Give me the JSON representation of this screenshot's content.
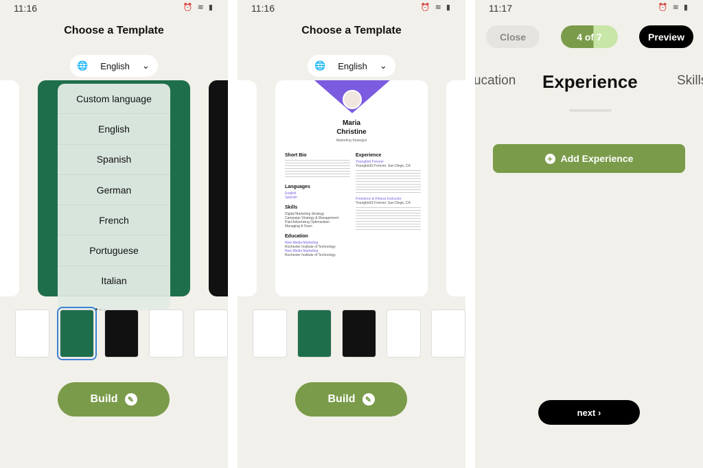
{
  "screens": [
    {
      "time": "11:16",
      "title": "Choose a Template",
      "language": "English",
      "build": "Build",
      "languages": [
        "Custom language",
        "English",
        "Spanish",
        "German",
        "French",
        "Portuguese",
        "Italian",
        "Japanese"
      ]
    },
    {
      "time": "11:16",
      "title": "Choose a Template",
      "language": "English",
      "build": "Build",
      "resume": {
        "first": "Maria",
        "last": "Christine",
        "role": "Marketing Strategist",
        "short_bio": "Short Bio",
        "languages_h": "Languages",
        "languages": [
          "English",
          "Spanish"
        ],
        "skills_h": "Skills",
        "skills": [
          "Digital Marketing Strategy",
          "Campaign Strategy & Management",
          "Paid Advertising Optimization",
          "Managing A Team"
        ],
        "education_h": "Education",
        "education": [
          {
            "degree": "New Media Marketing",
            "school": "Rochester Institute of Technology"
          },
          {
            "degree": "New Media Marketing",
            "school": "Rochester Institute of Technology"
          }
        ],
        "experience_h": "Experience",
        "experience": [
          {
            "title": "Youngbird Forever",
            "company": "YoungbirdS Forever, San Diego, CA"
          },
          {
            "title": "Freelance & Fitness Instructor",
            "company": "YoungbirdS Forever, San Diego, CA"
          }
        ]
      }
    },
    {
      "time": "11:17",
      "close": "Close",
      "progress": "4 of 7",
      "progress_fraction": 0.57,
      "preview": "Preview",
      "prev_section": "ucation",
      "section": "Experience",
      "next_section": "Skills",
      "add": "Add Experience",
      "next": "next ›"
    }
  ],
  "colors": {
    "accent_green": "#7a9b4a",
    "card_green": "#1f6e4b",
    "resume_purple": "#7b5ce0"
  }
}
